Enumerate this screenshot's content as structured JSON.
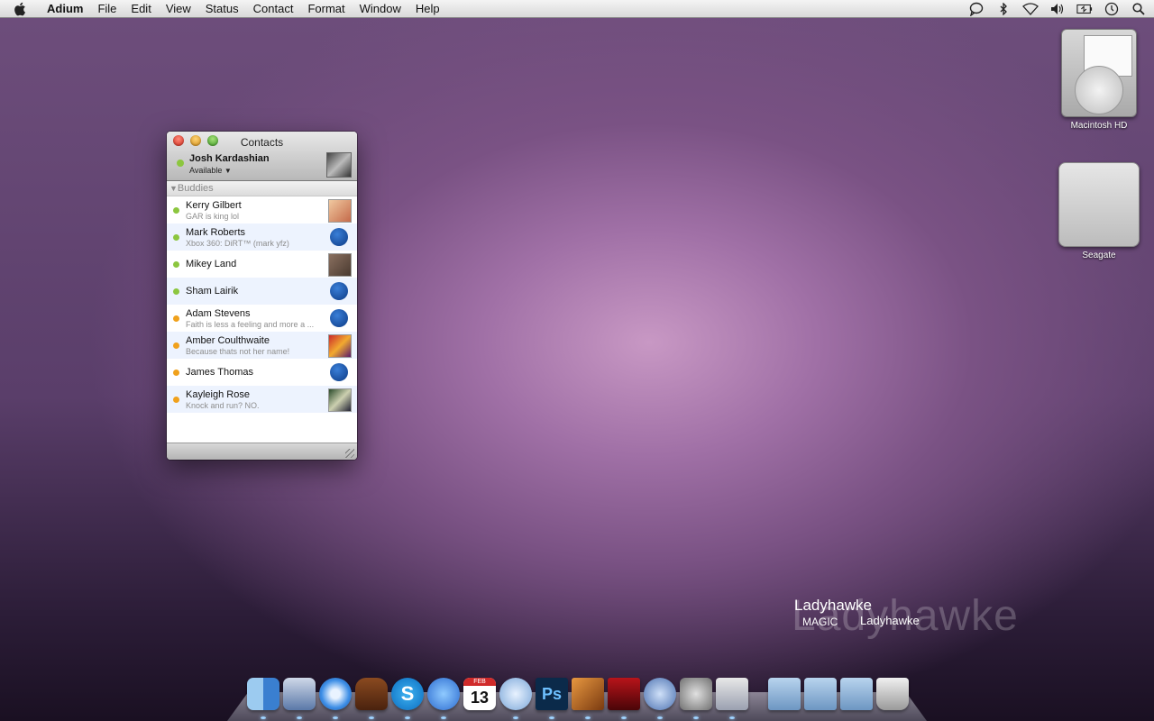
{
  "menubar": {
    "app_name": "Adium",
    "menus": [
      "File",
      "Edit",
      "View",
      "Status",
      "Contact",
      "Format",
      "Window",
      "Help"
    ],
    "extras_icons": [
      "chat-bubble-icon",
      "bluetooth-icon",
      "wifi-icon",
      "volume-icon",
      "battery-icon",
      "clock-icon",
      "spotlight-icon"
    ]
  },
  "desktop": {
    "icons": [
      {
        "label": "Macintosh HD",
        "icon": "hard-drive-icon"
      },
      {
        "label": "Seagate",
        "icon": "external-drive-icon"
      }
    ]
  },
  "contacts_window": {
    "title": "Contacts",
    "user": {
      "name": "Josh Kardashian",
      "status": "Available"
    },
    "group": "Buddies",
    "buddies": [
      {
        "name": "Kerry Gilbert",
        "message": "GAR is king lol",
        "status": "available"
      },
      {
        "name": "Mark Roberts",
        "message": "Xbox 360: DiRT™ (mark yfz)",
        "status": "available"
      },
      {
        "name": "Mikey Land",
        "message": "",
        "status": "available"
      },
      {
        "name": "Sham Lairik",
        "message": "",
        "status": "available"
      },
      {
        "name": "Adam Stevens",
        "message": "Faith is less a feeling and more a ...",
        "status": "away"
      },
      {
        "name": "Amber Coulthwaite",
        "message": "Because thats not her name!",
        "status": "away"
      },
      {
        "name": "James Thomas",
        "message": "",
        "status": "away"
      },
      {
        "name": "Kayleigh Rose",
        "message": "Knock and run? NO.",
        "status": "away"
      }
    ]
  },
  "now_playing": {
    "artist": "Ladyhawke",
    "track": "MAGIC",
    "album": "Ladyhawke",
    "background_text": "Ladyhawke"
  },
  "dock": {
    "apps": [
      "Finder",
      "Mail",
      "Safari",
      "Domo",
      "Skype",
      "iChat",
      "iCal",
      "iTunes",
      "Photoshop",
      "Preview",
      "Front Row",
      "Xcode",
      "System Preferences",
      "Automator"
    ],
    "stacks": [
      "Applications",
      "Documents",
      "Downloads",
      "Trash"
    ],
    "calendar_day": "13",
    "calendar_month": "FEB",
    "photoshop_label": "Ps"
  }
}
